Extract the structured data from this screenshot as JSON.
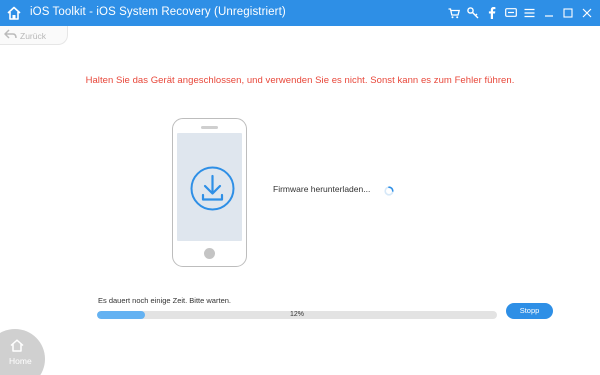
{
  "window": {
    "title": "iOS Toolkit - iOS System Recovery (Unregistriert)",
    "title_icons": [
      "cart-icon",
      "key-icon",
      "facebook-icon",
      "feedback-icon",
      "menu-icon",
      "minimize-icon",
      "maximize-icon",
      "close-icon"
    ]
  },
  "nav": {
    "back_label": "Zurück"
  },
  "main": {
    "warning": "Halten Sie das Gerät angeschlossen, und verwenden Sie es nicht. Sonst kann es zum Fehler führen.",
    "status": "Firmware herunterladen...",
    "hint": "Es dauert noch einige Zeit. Bitte warten.",
    "progress_value": 0.12,
    "progress_text": "12%",
    "stop_label": "Stopp"
  },
  "footer": {
    "home_label": "Home"
  },
  "colors": {
    "titlebar": "#2e8fe6",
    "warning": "#e8473a",
    "progress_fill": "#64b2f2",
    "accent": "#2e8fe6"
  }
}
